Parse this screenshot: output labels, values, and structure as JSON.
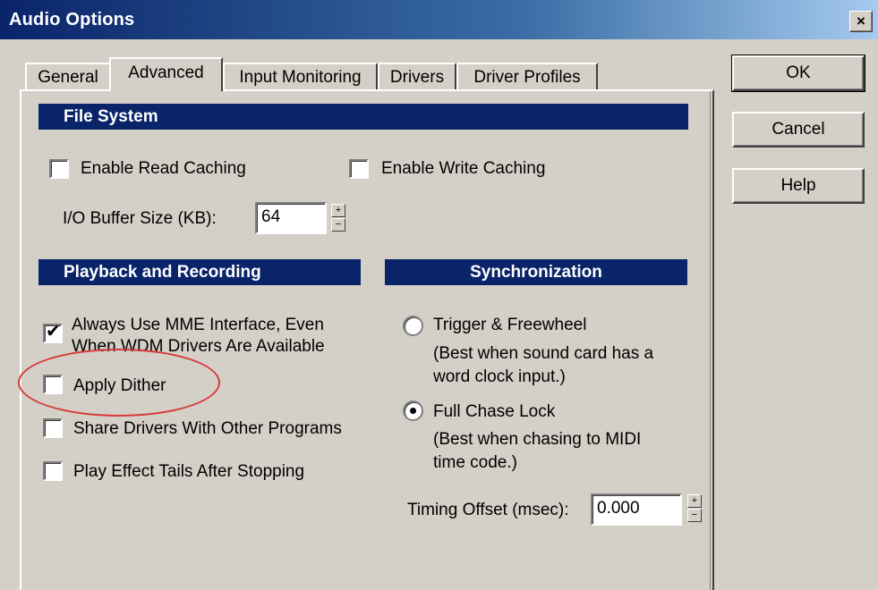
{
  "window": {
    "title": "Audio Options",
    "close_label": "×"
  },
  "tabs": [
    {
      "label": "General",
      "active": false
    },
    {
      "label": "Advanced",
      "active": true
    },
    {
      "label": "Input Monitoring",
      "active": false
    },
    {
      "label": "Drivers",
      "active": false
    },
    {
      "label": "Driver Profiles",
      "active": false
    }
  ],
  "file_system": {
    "header": "File System",
    "read_caching": {
      "label": "Enable Read Caching",
      "checked": false
    },
    "write_caching": {
      "label": "Enable Write Caching",
      "checked": false
    },
    "buffer_label": "I/O Buffer Size (KB):",
    "buffer_value": "64"
  },
  "playback": {
    "header": "Playback and Recording",
    "mme": {
      "label_line1": "Always Use MME Interface, Even",
      "label_line2": "When WDM Drivers Are Available",
      "checked": true
    },
    "dither": {
      "label": "Apply Dither",
      "checked": false
    },
    "share": {
      "label": "Share Drivers With Other Programs",
      "checked": false
    },
    "tails": {
      "label": "Play Effect Tails After Stopping",
      "checked": false
    }
  },
  "sync": {
    "header": "Synchronization",
    "trigger": {
      "label": "Trigger & Freewheel",
      "desc_line1": "(Best when sound card has a",
      "desc_line2": "word clock input.)",
      "selected": false
    },
    "chase": {
      "label": "Full Chase Lock",
      "desc_line1": "(Best when chasing to MIDI",
      "desc_line2": "time code.)",
      "selected": true
    },
    "offset_label": "Timing Offset (msec):",
    "offset_value": "0.000"
  },
  "buttons": {
    "ok": "OK",
    "cancel": "Cancel",
    "help": "Help"
  },
  "colors": {
    "section_header": "#0a246a",
    "dialog_bg": "#d4d0c8",
    "annotation": "#d73a3a"
  }
}
